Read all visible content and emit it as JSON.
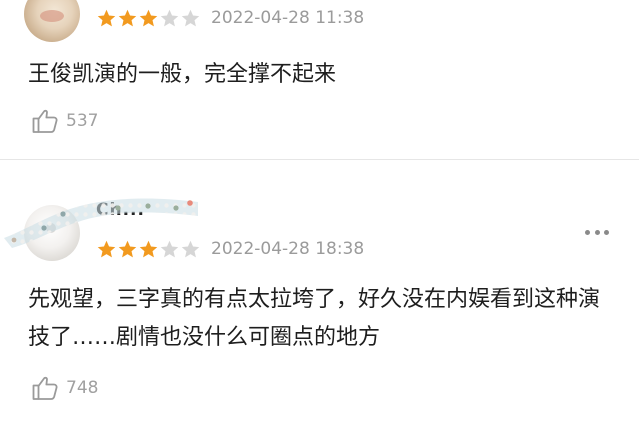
{
  "reviews": [
    {
      "username": "",
      "rating": 3,
      "max_rating": 5,
      "date": "2022-04-28 11:38",
      "content": "王俊凯演的一般，完全撑不起来",
      "likes": "537"
    },
    {
      "username": "Ch...",
      "rating": 3,
      "max_rating": 5,
      "date": "2022-04-28 18:38",
      "content": "先观望，三字真的有点太拉垮了，好久没在内娱看到这种演技了……剧情也没什么可圈点的地方",
      "likes": "748"
    }
  ],
  "icons": {
    "star": "star-icon",
    "like": "thumbs-up-icon",
    "more": "more-dots-icon"
  },
  "colors": {
    "star_filled": "#f29a1f",
    "star_empty": "#d6d6d6",
    "meta_text": "#9b9b9b",
    "divider": "#e6e6e6"
  }
}
